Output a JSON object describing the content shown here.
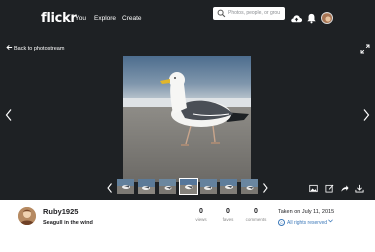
{
  "header": {
    "logo": "flickr",
    "nav": [
      "You",
      "Explore",
      "Create"
    ],
    "search_placeholder": "Photos, people, or grou",
    "icons": [
      "search-icon",
      "upload-cloud-icon",
      "notifications-bell-icon",
      "user-avatar"
    ]
  },
  "viewer": {
    "back_label": "Back to photostream",
    "icons": [
      "back-arrow-icon",
      "expand-icon",
      "chevron-left-icon",
      "chevron-right-icon"
    ],
    "filmstrip_icons": [
      "photo-icon",
      "edit-icon",
      "share-icon",
      "download-icon"
    ]
  },
  "info": {
    "username": "Ruby1925",
    "caption": "Seagull in the wind",
    "stats": [
      {
        "value": "0",
        "label": "views"
      },
      {
        "value": "0",
        "label": "faves"
      },
      {
        "value": "0",
        "label": "comments"
      }
    ],
    "taken": "Taken on July 11, 2015",
    "rights": "All rights reserved",
    "rights_symbol": "c"
  },
  "colors": {
    "header_bg": "#1e2124",
    "link_blue": "#3b78b9",
    "text": "#212124"
  }
}
